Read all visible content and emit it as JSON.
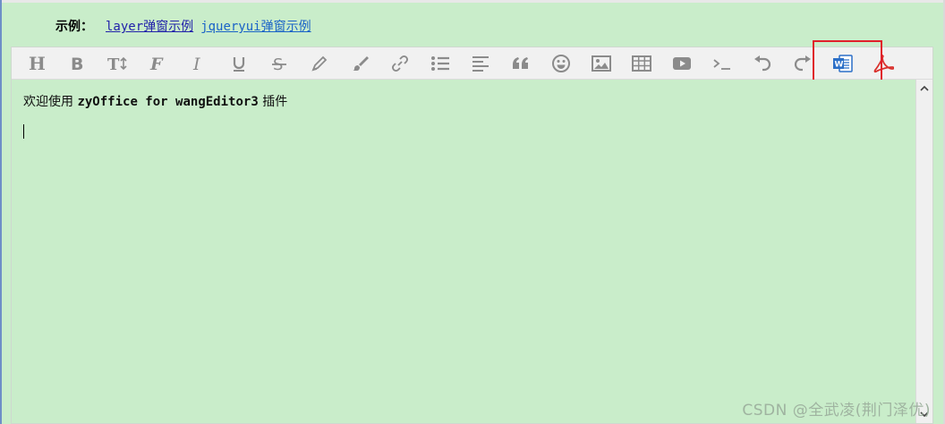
{
  "examples": {
    "label": "示例：",
    "links": [
      "layer弹窗示例",
      "jqueryui弹窗示例"
    ]
  },
  "toolbar": {
    "buttons": [
      "header-icon",
      "bold-icon",
      "font-size-icon",
      "font-family-icon",
      "italic-icon",
      "underline-icon",
      "strikethrough-icon",
      "text-color-icon",
      "background-color-icon",
      "link-icon",
      "list-icon",
      "justify-icon",
      "quote-icon",
      "emoticon-icon",
      "image-icon",
      "table-icon",
      "video-icon",
      "code-icon",
      "undo-icon",
      "redo-icon",
      "word-import-icon",
      "pdf-import-icon"
    ],
    "highlight_color": "#e0202a"
  },
  "content": {
    "line1_prefix": "欢迎使用 ",
    "line1_code": "zyOffice for wangEditor3",
    "line1_suffix": " 插件"
  },
  "watermark": "CSDN @全武凌(荆门泽优)"
}
